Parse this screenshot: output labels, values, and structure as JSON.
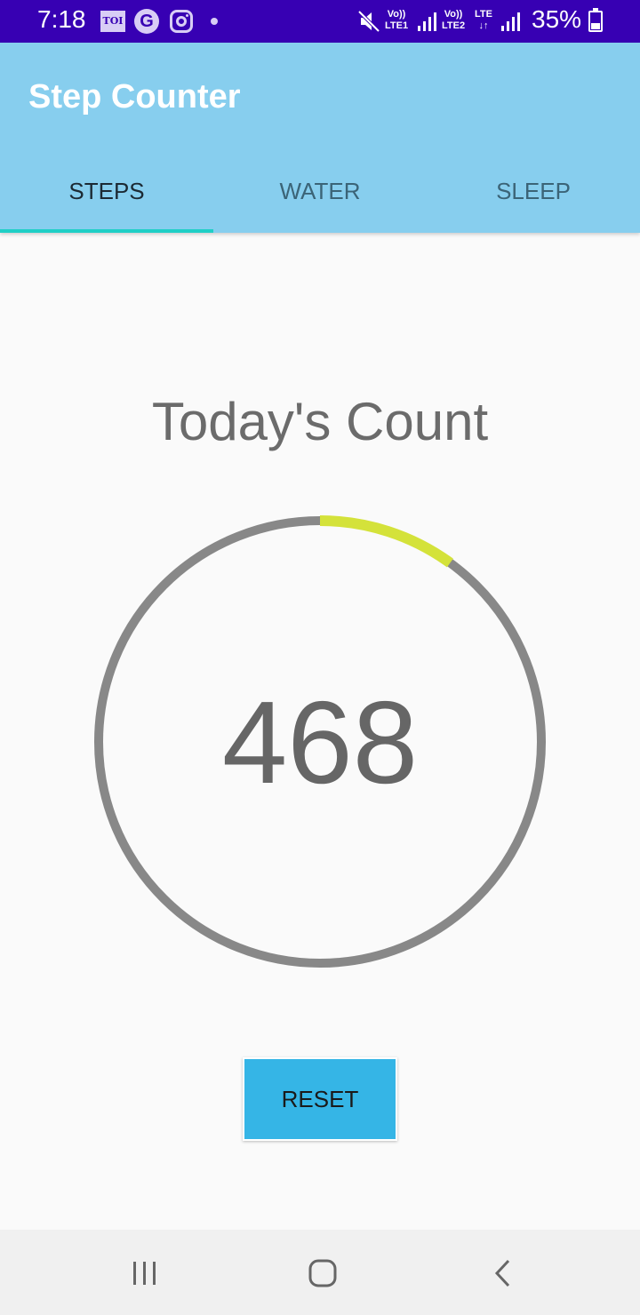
{
  "status_bar": {
    "time": "7:18",
    "toi_label": "TOI",
    "google_label": "G",
    "sim1_text": "Vo))\nLTE1",
    "sim2_text": "Vo))\nLTE2",
    "lte_text": "LTE\n↓↑",
    "battery": "35%"
  },
  "app_bar": {
    "title": "Step Counter",
    "tabs": [
      "STEPS",
      "WATER",
      "SLEEP"
    ],
    "active_tab": "STEPS"
  },
  "main": {
    "heading": "Today's Count",
    "count": "468",
    "progress_fraction": 0.1,
    "reset_label": "RESET"
  },
  "nav_bar": {
    "buttons": [
      "recents-icon",
      "home-icon",
      "back-icon"
    ]
  },
  "colors": {
    "status_bar": "#3700b3",
    "app_bar": "#87ceee",
    "tab_indicator": "#1fcfc6",
    "ring_track": "#888888",
    "ring_progress": "#d4e23a",
    "reset_button": "#35b5e6"
  }
}
